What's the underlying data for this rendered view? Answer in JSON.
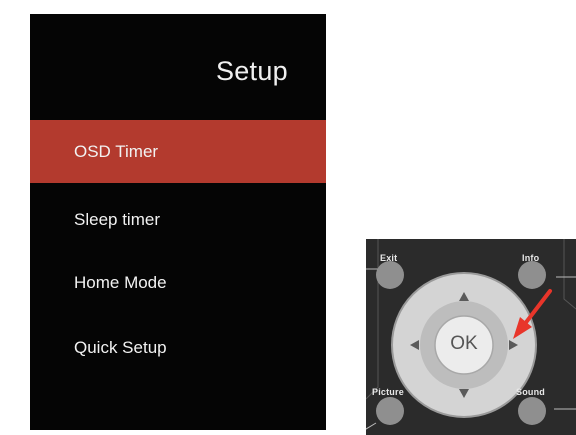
{
  "menu": {
    "title": "Setup",
    "items": [
      {
        "label": "OSD Timer",
        "selected": true
      },
      {
        "label": "Sleep timer",
        "selected": false
      },
      {
        "label": "Home Mode",
        "selected": false
      },
      {
        "label": "Quick Setup",
        "selected": false
      }
    ]
  },
  "remote": {
    "exit_label": "Exit",
    "info_label": "Info",
    "picture_label": "Picture",
    "sound_label": "Sound",
    "ok_label": "OK"
  },
  "colors": {
    "menu_background": "#050505",
    "selected_item": "#b33a2e",
    "remote_body": "#2b2b2b",
    "dpad": "#cfcfcf",
    "pointer_arrow": "#e8352a"
  }
}
